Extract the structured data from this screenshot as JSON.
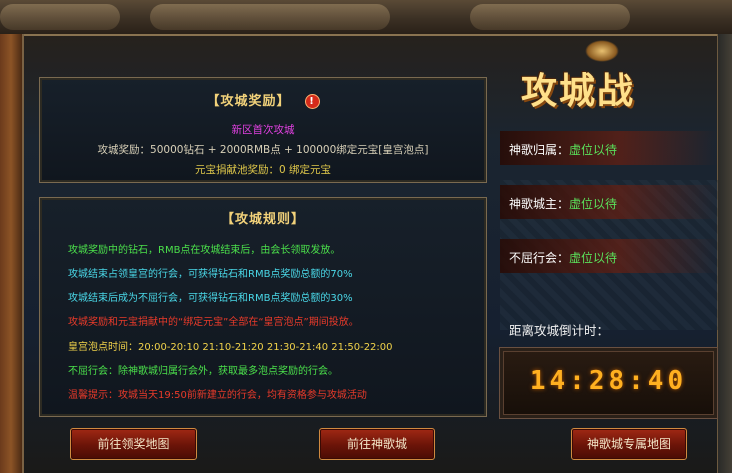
{
  "reward_panel": {
    "title": "【攻城奖励】",
    "warn_icon": "!",
    "line1": "新区首次攻城",
    "line2": "攻城奖励：50000钻石 + 2000RMB点 + 100000绑定元宝[皇宫泡点]",
    "line3": "元宝捐献池奖励：0 绑定元宝"
  },
  "rules_panel": {
    "title": "【攻城规则】",
    "rules": [
      "攻城奖励中的钻石，RMB点在攻城结束后，由会长领取发放。",
      "攻城结束占领皇宫的行会，可获得钻石和RMB点奖励总额的70%",
      "攻城结束后成为不屈行会，可获得钻石和RMB点奖励总额的30%",
      "攻城奖励和元宝捐献中的“绑定元宝”全部在“皇宫泡点”期间投放。",
      "皇宫泡点时间：20:00-20:10   21:10-21:20   21:30-21:40   21:50-22:00",
      "不屈行会：除神歌城归属行会外，获取最多泡点奖励的行会。",
      "温馨提示：攻城当天19:50前新建立的行会，均有资格参与攻城活动"
    ]
  },
  "siege": {
    "title": "攻城战",
    "owner_label": "神歌归属：",
    "owner_value": "虚位以待",
    "lord_label": "神歌城主：",
    "lord_value": "虚位以待",
    "unyielding_label": "不屈行会：",
    "unyielding_value": "虚位以待",
    "countdown_label": "距离攻城倒计时：",
    "countdown_value": "14:28:40"
  },
  "buttons": {
    "goto_reward_map": "前往领奖地图",
    "goto_shenge": "前往神歌城",
    "shenge_private_map": "神歌城专属地图"
  },
  "colors": {
    "accent_gold": "#f2d27a",
    "green": "#4be04b",
    "cyan": "#4ad8e8",
    "red": "#e83a2a",
    "yellow": "#f0d24a"
  }
}
